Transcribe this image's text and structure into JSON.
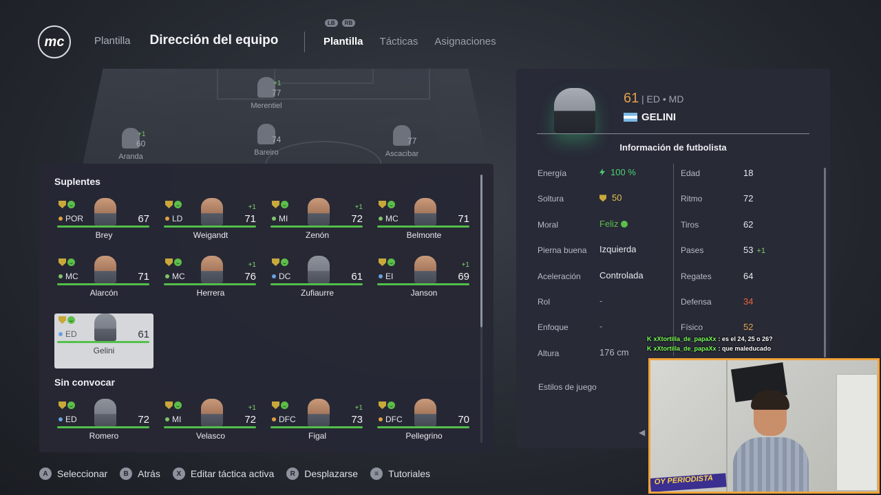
{
  "header": {
    "logo_text": "mc",
    "crumb": "Plantilla",
    "title": "Dirección del equipo",
    "bumpers": [
      "LB",
      "RB"
    ],
    "tabs": [
      "Plantilla",
      "Tácticas",
      "Asignaciones"
    ],
    "active_tab": "Plantilla"
  },
  "pitch_players": [
    {
      "name": "Merentiel",
      "rating": "77",
      "delta": "+1"
    },
    {
      "name": "Aranda",
      "rating": "60",
      "delta": "+1"
    },
    {
      "name": "Bareiro",
      "rating": "74",
      "delta": ""
    },
    {
      "name": "Ascacibar",
      "rating": "77",
      "delta": ""
    }
  ],
  "bench": {
    "suplentes_title": "Suplentes",
    "sin_convocar_title": "Sin convocar",
    "suplentes": [
      {
        "name": "Brey",
        "pos": "POR",
        "ovr": "67",
        "delta": "",
        "dot": "#e0a040"
      },
      {
        "name": "Weigandt",
        "pos": "LD",
        "ovr": "71",
        "delta": "+1",
        "dot": "#e0a040"
      },
      {
        "name": "Zenón",
        "pos": "MI",
        "ovr": "72",
        "delta": "+1",
        "dot": "#7fc46b"
      },
      {
        "name": "Belmonte",
        "pos": "MC",
        "ovr": "71",
        "delta": "",
        "dot": "#7fc46b"
      },
      {
        "name": "Alarcón",
        "pos": "MC",
        "ovr": "71",
        "delta": "",
        "dot": "#7fc46b"
      },
      {
        "name": "Herrera",
        "pos": "MC",
        "ovr": "76",
        "delta": "+1",
        "dot": "#7fc46b"
      },
      {
        "name": "Zufiaurre",
        "pos": "DC",
        "ovr": "61",
        "delta": "",
        "dot": "#6aa0e0"
      },
      {
        "name": "Janson",
        "pos": "EI",
        "ovr": "69",
        "delta": "+1",
        "dot": "#6aa0e0"
      },
      {
        "name": "Gelini",
        "pos": "ED",
        "ovr": "61",
        "delta": "",
        "dot": "#6aa0e0"
      }
    ],
    "sin_convocar": [
      {
        "name": "Romero",
        "pos": "ED",
        "ovr": "72",
        "delta": "",
        "dot": "#6aa0e0"
      },
      {
        "name": "Velasco",
        "pos": "MI",
        "ovr": "72",
        "delta": "+1",
        "dot": "#7fc46b"
      },
      {
        "name": "Figal",
        "pos": "DFC",
        "ovr": "73",
        "delta": "+1",
        "dot": "#e0a040"
      },
      {
        "name": "Pellegrino",
        "pos": "DFC",
        "ovr": "70",
        "delta": "",
        "dot": "#e0a040"
      }
    ]
  },
  "player": {
    "rating": "61",
    "positions": "| ED • MD",
    "name": "GELINI",
    "section": "Información de futbolista",
    "left_stats": [
      {
        "label": "Energía",
        "value": "100 %",
        "color": "#4fd070"
      },
      {
        "label": "Soltura",
        "value": "50",
        "color": "#e3c04c"
      },
      {
        "label": "Moral",
        "value": "Feliz",
        "color": "#5cbf4a"
      },
      {
        "label": "Pierna buena",
        "value": "Izquierda",
        "color": "#e7e9ee"
      },
      {
        "label": "Aceleración",
        "value": "Controlada",
        "color": "#e7e9ee"
      },
      {
        "label": "Rol",
        "value": "-",
        "color": "#9ba0aa"
      },
      {
        "label": "Enfoque",
        "value": "-",
        "color": "#9ba0aa"
      },
      {
        "label": "Altura",
        "value": "176 cm",
        "color": "#b8bcc6"
      }
    ],
    "right_stats": [
      {
        "label": "Edad",
        "value": "18",
        "extra": "",
        "color": "#e7e9ee"
      },
      {
        "label": "Ritmo",
        "value": "72",
        "extra": "",
        "color": "#e7e9ee"
      },
      {
        "label": "Tiros",
        "value": "62",
        "extra": "",
        "color": "#e7e9ee"
      },
      {
        "label": "Pases",
        "value": "53",
        "extra": "+1",
        "color": "#e7e9ee"
      },
      {
        "label": "Regates",
        "value": "64",
        "extra": "",
        "color": "#e7e9ee"
      },
      {
        "label": "Defensa",
        "value": "34",
        "extra": "",
        "color": "#e8673c"
      },
      {
        "label": "Físico",
        "value": "52",
        "extra": "",
        "color": "#e3a04c"
      }
    ],
    "styles_label": "Estilos de juego"
  },
  "footer": [
    {
      "btn": "A",
      "label": "Seleccionar"
    },
    {
      "btn": "B",
      "label": "Atrás"
    },
    {
      "btn": "X",
      "label": "Editar táctica activa"
    },
    {
      "btn": "R",
      "label": "Desplazarse"
    },
    {
      "btn": "≡",
      "label": "Tutoriales"
    }
  ],
  "chat": [
    {
      "user": "xXtortilla_de_papaXx",
      "message": ": es el 24, 25 o 26?"
    },
    {
      "user": "xXtortilla_de_papaXx",
      "message": ": que maleducado"
    }
  ],
  "webcam": {
    "banner": "OY PERIODISTA"
  }
}
